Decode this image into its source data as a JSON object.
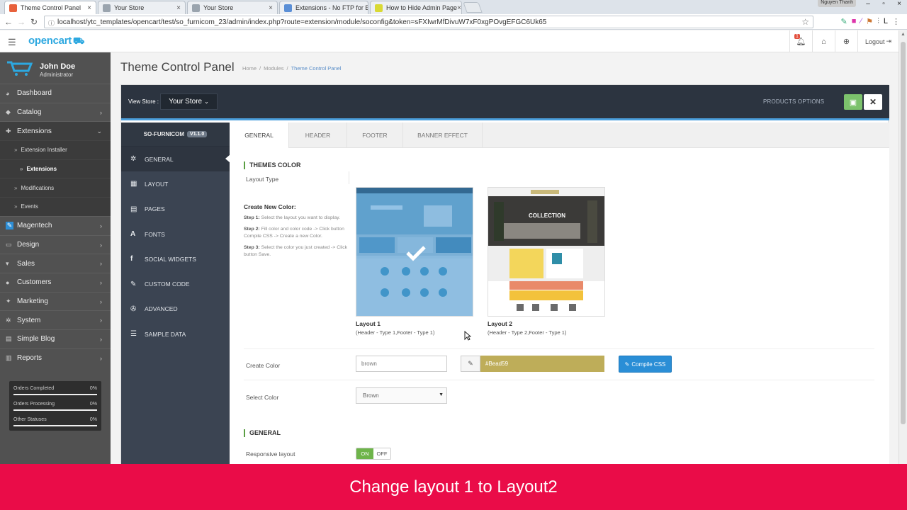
{
  "browser": {
    "tabs": [
      {
        "title": "Theme Control Panel",
        "active": true,
        "color": "#e8613c"
      },
      {
        "title": "Your Store",
        "active": false,
        "color": "#9aa4ae"
      },
      {
        "title": "Your Store",
        "active": false,
        "color": "#9aa4ae"
      },
      {
        "title": "Extensions - No FTP for E",
        "active": false,
        "color": "#5b8fd6"
      },
      {
        "title": "How to Hide Admin Page",
        "active": false,
        "color": "#d9d934"
      }
    ],
    "user_badge": "Nguyen Thanh",
    "url": "localhost/ytc_templates/opencart/test/so_furnicom_23/admin/index.php?route=extension/module/soconfig&token=sFXIwrMfDivuW7xF0xgPOvgEFGC6Uk65"
  },
  "header": {
    "logo": "opencart",
    "alerts_count": "1",
    "logout_label": "Logout"
  },
  "profile": {
    "name": "John Doe",
    "role": "Administrator"
  },
  "sidebar": {
    "items": [
      {
        "label": "Dashboard",
        "icon": "dashboard-icon",
        "glyph": "◕"
      },
      {
        "label": "Catalog",
        "icon": "tag-icon",
        "glyph": "◆"
      },
      {
        "label": "Extensions",
        "icon": "puzzle-icon",
        "glyph": "✚"
      },
      {
        "label": "Magentech",
        "icon": "magentech-icon",
        "glyph": "✎"
      },
      {
        "label": "Design",
        "icon": "monitor-icon",
        "glyph": "▭"
      },
      {
        "label": "Sales",
        "icon": "cart-icon",
        "glyph": "▾"
      },
      {
        "label": "Customers",
        "icon": "user-icon",
        "glyph": "●"
      },
      {
        "label": "Marketing",
        "icon": "share-icon",
        "glyph": "✦"
      },
      {
        "label": "System",
        "icon": "gear-icon",
        "glyph": "✲"
      },
      {
        "label": "Simple Blog",
        "icon": "blog-icon",
        "glyph": "▤"
      },
      {
        "label": "Reports",
        "icon": "bar-chart-icon",
        "glyph": "▥"
      }
    ],
    "extensions_sub": [
      "Extension Installer",
      "Extensions",
      "Modifications",
      "Events"
    ],
    "stats": [
      {
        "label": "Orders Completed",
        "value": "0%"
      },
      {
        "label": "Orders Processing",
        "value": "0%"
      },
      {
        "label": "Other Statuses",
        "value": "0%"
      }
    ]
  },
  "page": {
    "title": "Theme Control Panel",
    "breadcrumb": [
      "Home",
      "Modules",
      "Theme Control Panel"
    ]
  },
  "toolbar": {
    "view_store_label": "View Store :",
    "store_value": "Your Store",
    "products_options": "PRODUCTS OPTIONS"
  },
  "theme": {
    "name": "SO-FURNICOM",
    "version": "V1.1.0"
  },
  "leftnav": [
    {
      "label": "GENERAL",
      "icon": "gear-icon",
      "glyph": "✲"
    },
    {
      "label": "LAYOUT",
      "icon": "grid-icon",
      "glyph": "▦"
    },
    {
      "label": "PAGES",
      "icon": "file-icon",
      "glyph": "▤"
    },
    {
      "label": "FONTS",
      "icon": "font-icon",
      "glyph": "A"
    },
    {
      "label": "SOCIAL WIDGETS",
      "icon": "facebook-icon",
      "glyph": "f"
    },
    {
      "label": "CUSTOM CODE",
      "icon": "edit-icon",
      "glyph": "✎"
    },
    {
      "label": "ADVANCED",
      "icon": "wrench-icon",
      "glyph": "✇"
    },
    {
      "label": "SAMPLE DATA",
      "icon": "database-icon",
      "glyph": "☰"
    }
  ],
  "tabs": [
    "GENERAL",
    "HEADER",
    "FOOTER",
    "BANNER EFFECT"
  ],
  "themes_color": {
    "heading": "THEMES COLOR",
    "layout_type_label": "Layout Type",
    "create_new_color": "Create New Color:",
    "steps": [
      {
        "head": "Step 1:",
        "text": "Select the layout you want to display."
      },
      {
        "head": "Step 2:",
        "text": "Fill color and color code -> Click button Compile CSS -> Create a new Color."
      },
      {
        "head": "Step 3:",
        "text": "Select the color you just created -> Click button Save."
      }
    ],
    "layouts": [
      {
        "name": "Layout 1",
        "desc": "(Header - Type 1,Footer - Type 1)",
        "selected": true
      },
      {
        "name": "Layout 2",
        "desc": "(Header - Type 2,Footer - Type 1)",
        "selected": false,
        "banner_text": "COLLECTION"
      }
    ],
    "create_color_label": "Create Color",
    "create_color_value": "brown",
    "color_code": "#Bead59",
    "color_code_hex": "#bead59",
    "compile_label": "Compile CSS",
    "select_color_label": "Select Color",
    "select_color_value": "Brown"
  },
  "general": {
    "heading": "GENERAL",
    "responsive_label": "Responsive layout",
    "on": "ON",
    "off": "OFF"
  },
  "caption": "Change layout 1 to Layout2"
}
